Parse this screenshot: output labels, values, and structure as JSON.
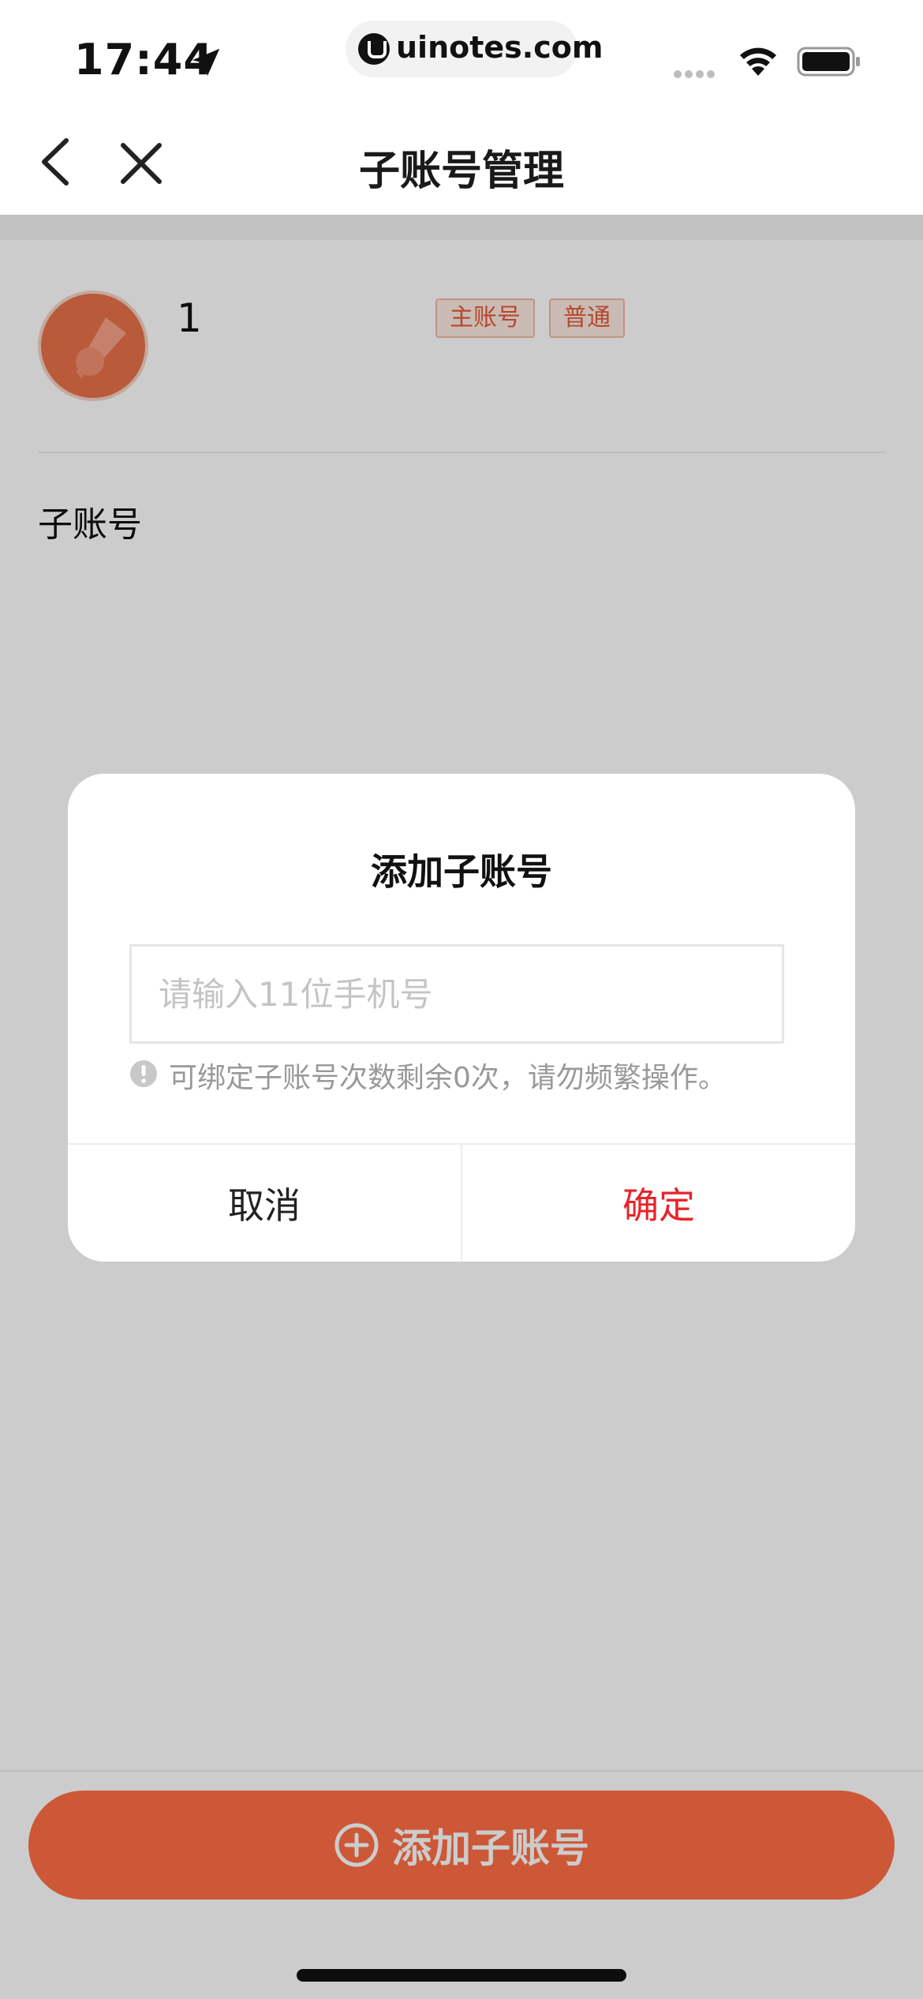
{
  "status_bar": {
    "time": "17:44",
    "url": "uinotes.com"
  },
  "nav": {
    "title": "子账号管理"
  },
  "account": {
    "name": "1",
    "badges": [
      "主账号",
      "普通"
    ]
  },
  "section": {
    "label": "子账号"
  },
  "add_button": {
    "label": "添加子账号"
  },
  "dialog": {
    "title": "添加子账号",
    "input_placeholder": "请输入11位手机号",
    "input_value": "",
    "warning": "可绑定子账号次数剩余0次，请勿频繁操作。",
    "cancel_label": "取消",
    "confirm_label": "确定"
  },
  "colors": {
    "accent": "#ff6f45",
    "confirm": "#e8232a",
    "overlay": "rgba(0,0,0,0.2)"
  },
  "icons": {
    "location": "location-arrow-icon",
    "back": "chevron-left-icon",
    "close": "close-icon",
    "add": "plus-circle-icon",
    "warning": "exclamation-circle-icon"
  }
}
